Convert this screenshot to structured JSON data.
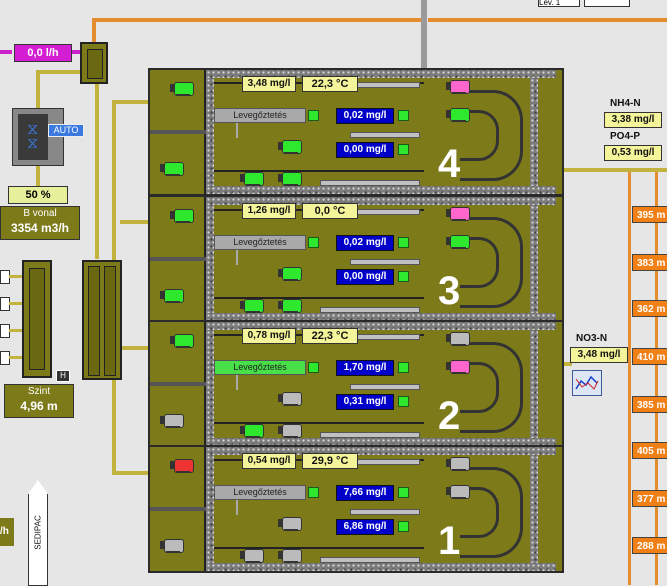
{
  "top_right": {
    "field1": "Lev. 1",
    "field2": ""
  },
  "flow_badge": "0,0 l/h",
  "valve": {
    "auto_label": "AUTO",
    "percent": "50 %"
  },
  "b_line": {
    "label": "B vonal",
    "value": "3354 m3/h"
  },
  "level": {
    "label": "Szint",
    "value": "4,96 m",
    "marker": "H"
  },
  "sedipac": "SEDIPAC",
  "left_edge_text": "/h",
  "nh4": {
    "label": "NH4-N",
    "value": "3,38 mg/l"
  },
  "po4": {
    "label": "PO4-P",
    "value": "0,53 mg/l"
  },
  "no3": {
    "label": "NO3-N",
    "value": "3,48 mg/l"
  },
  "right_values": [
    "395 m",
    "383 m",
    "362 m",
    "410 m",
    "385 m",
    "405 m",
    "377 m",
    "288 m"
  ],
  "tanks": [
    {
      "number": "4",
      "o2": "3,48 mg/l",
      "temp": "22,3 °C",
      "aeration": "Levegőztetés",
      "aeration_active": false,
      "v1": "0,02 mg/l",
      "v2": "0,00 mg/l",
      "motors": {
        "a": "#2ee82e",
        "b": "#ff66cc",
        "c": "#2ee82e",
        "d": "#2ee82e",
        "e": "#2ee82e",
        "f": "#2ee82e",
        "g": "#2ee82e"
      }
    },
    {
      "number": "3",
      "o2": "1,26 mg/l",
      "temp": "0,0 °C",
      "aeration": "Levegőztetés",
      "aeration_active": false,
      "v1": "0,02 mg/l",
      "v2": "0,00 mg/l",
      "motors": {
        "a": "#2ee82e",
        "b": "#ff66cc",
        "c": "#2ee82e",
        "d": "#2ee82e",
        "e": "#2ee82e",
        "f": "#2ee82e",
        "g": "#2ee82e"
      }
    },
    {
      "number": "2",
      "o2": "0,78 mg/l",
      "temp": "22,3 °C",
      "aeration": "Levegőztetés",
      "aeration_active": true,
      "v1": "1,70 mg/l",
      "v2": "0,31 mg/l",
      "motors": {
        "a": "#2ee82e",
        "b": "#bbbbbb",
        "c": "#bbbbbb",
        "d": "#ff66cc",
        "e": "#bbbbbb",
        "f": "#bbbbbb",
        "g": "#2ee82e"
      }
    },
    {
      "number": "1",
      "o2": "0,54 mg/l",
      "temp": "29,9 °C",
      "aeration": "Levegőztetés",
      "aeration_active": false,
      "v1": "7,66 mg/l",
      "v2": "6,86 mg/l",
      "motors": {
        "a": "#ee3333",
        "b": "#bbbbbb",
        "c": "#bbbbbb",
        "d": "#bbbbbb",
        "e": "#bbbbbb",
        "f": "#bbbbbb",
        "g": "#bbbbbb"
      }
    }
  ]
}
